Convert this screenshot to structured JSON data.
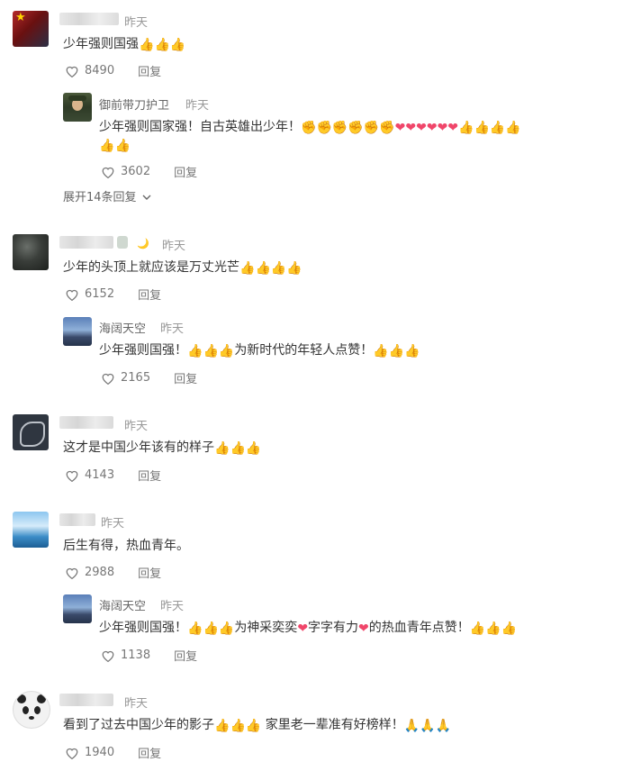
{
  "time_label": "昨天",
  "reply_label": "回复",
  "emoji": {
    "thumb": "👍",
    "fist": "✊",
    "heart": "❤",
    "pray": "🙏",
    "moon": "🌙"
  },
  "c1": {
    "text": "少年强则国强",
    "likes": "8490"
  },
  "r1": {
    "name": "御前带刀护卫",
    "text": "少年强则国家强！自古英雄出少年！",
    "likes": "3602"
  },
  "expand": "展开14条回复",
  "c2": {
    "text": "少年的头顶上就应该是万丈光芒",
    "likes": "6152"
  },
  "r2": {
    "name": "海阔天空",
    "text_a": "少年强则国强！",
    "text_b": "为新时代的年轻人点赞！",
    "likes": "2165"
  },
  "c3": {
    "text": "这才是中国少年该有的样子",
    "likes": "4143"
  },
  "c4": {
    "text": "后生有得，热血青年。",
    "likes": "2988"
  },
  "r3": {
    "name": "海阔天空",
    "text_a": "少年强则国强！",
    "text_b": "为神采奕奕",
    "text_c": "字字有力",
    "text_d": "的热血青年点赞！",
    "likes": "1138"
  },
  "c5": {
    "text_a": "看到了过去中国少年的影子",
    "text_b": "家里老一辈准有好榜样！",
    "likes": "1940"
  }
}
